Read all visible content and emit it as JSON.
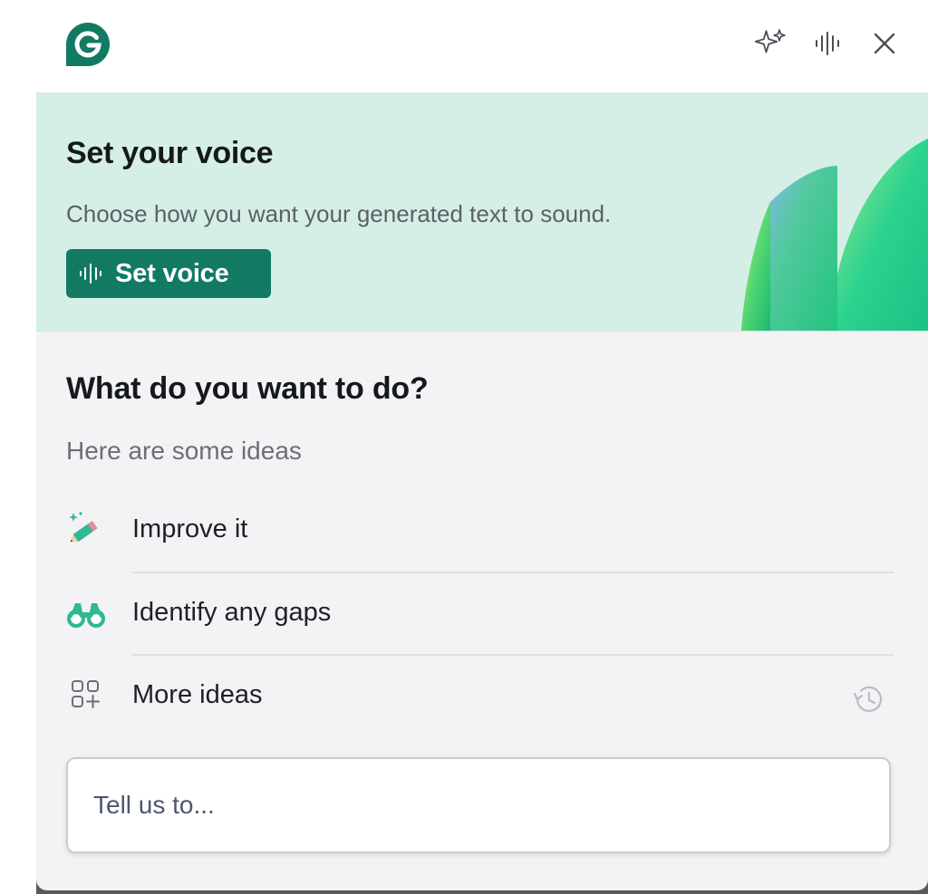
{
  "header": {
    "logo_letter": "G",
    "icons": [
      "sparkle-icon",
      "voice-waveform-icon",
      "close-icon"
    ]
  },
  "banner": {
    "title": "Set your voice",
    "subtitle": "Choose how you want your generated text to sound.",
    "button_label": "Set voice"
  },
  "ideas_section": {
    "title": "What do you want to do?",
    "subtitle": "Here are some ideas",
    "items": [
      {
        "label": "Improve it",
        "icon": "pencil-sparkle-icon"
      },
      {
        "label": "Identify any gaps",
        "icon": "binoculars-icon"
      },
      {
        "label": "More ideas",
        "icon": "grid-plus-icon"
      }
    ]
  },
  "prompt": {
    "placeholder": "Tell us to...",
    "value": ""
  },
  "colors": {
    "brand_green": "#127a63",
    "banner_bg": "#d5efe7",
    "panel_bg": "#f3f3f5"
  }
}
